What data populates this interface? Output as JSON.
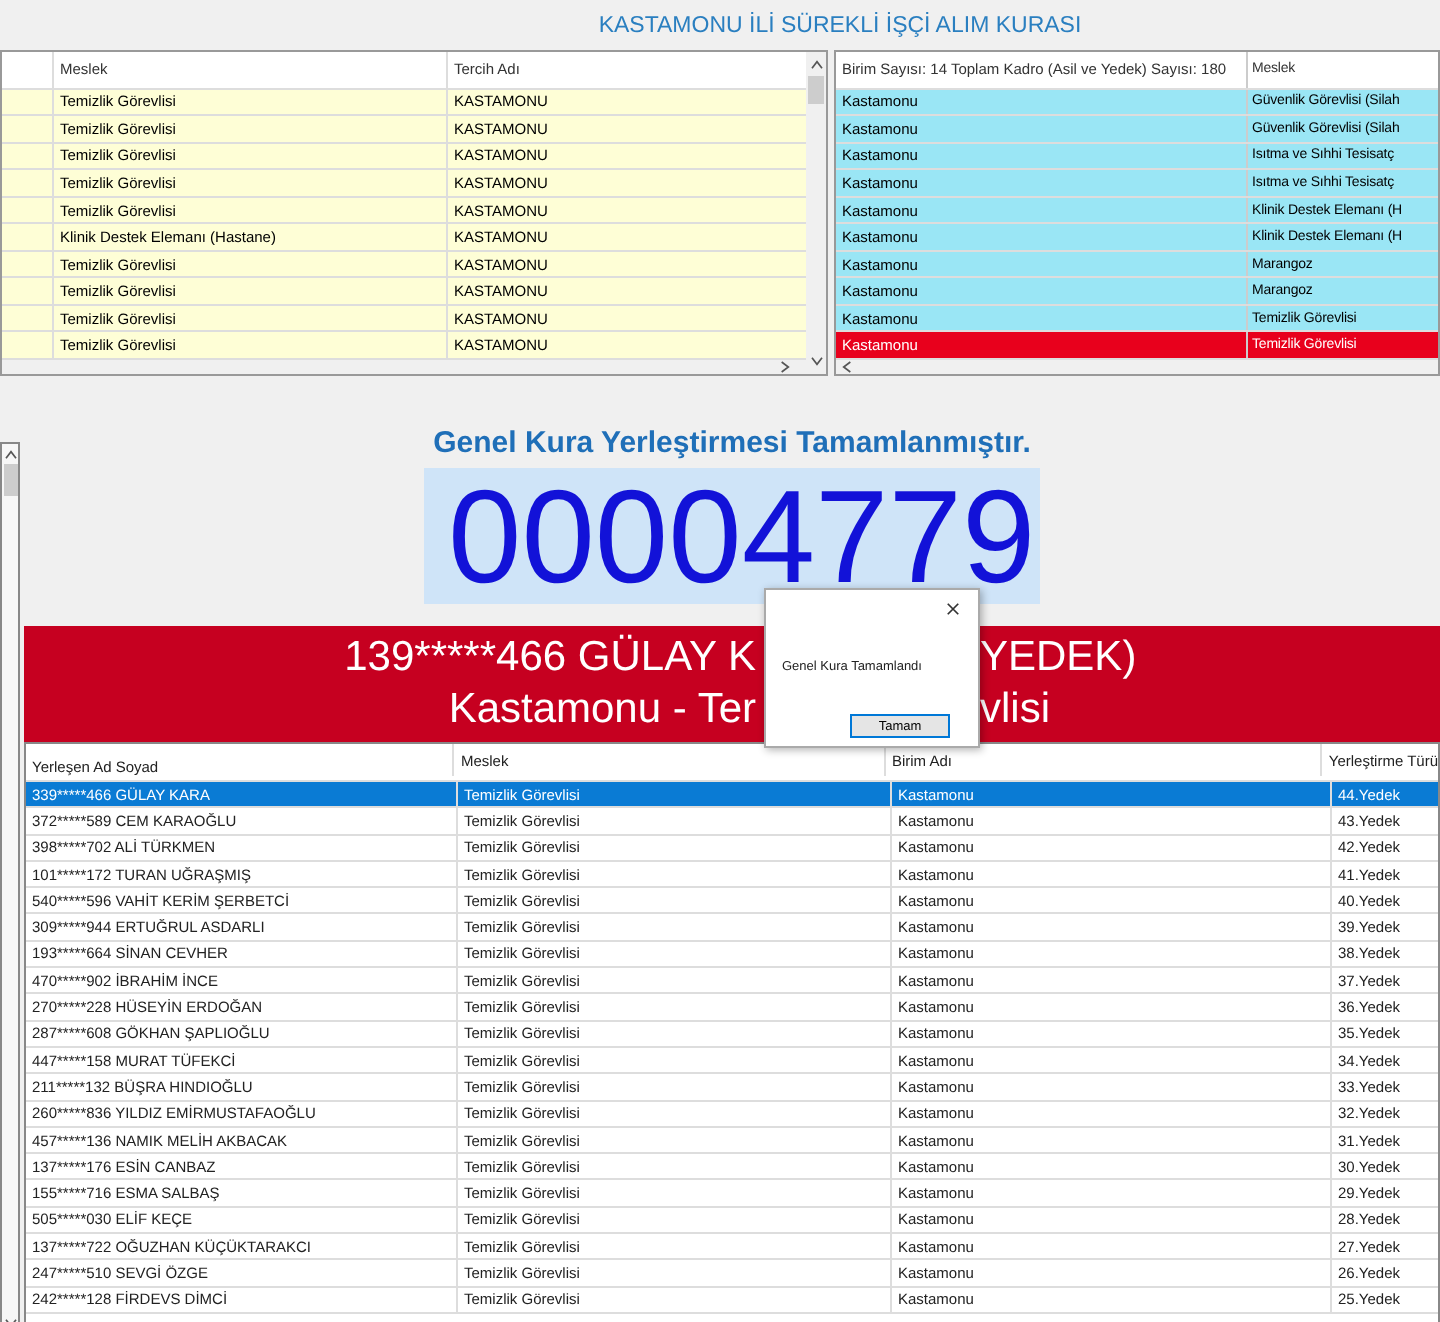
{
  "title": "KASTAMONU İLİ SÜREKLİ İŞÇİ ALIM KURASI",
  "preference_table": {
    "columns": [
      "Meslek",
      "Tercih Adı"
    ],
    "rows": [
      {
        "meslek": "Temizlik Görevlisi",
        "tercih": "KASTAMONU"
      },
      {
        "meslek": "Temizlik Görevlisi",
        "tercih": "KASTAMONU"
      },
      {
        "meslek": "Temizlik Görevlisi",
        "tercih": "KASTAMONU"
      },
      {
        "meslek": "Temizlik Görevlisi",
        "tercih": "KASTAMONU"
      },
      {
        "meslek": "Temizlik Görevlisi",
        "tercih": "KASTAMONU"
      },
      {
        "meslek": "Klinik Destek Elemanı (Hastane)",
        "tercih": "KASTAMONU"
      },
      {
        "meslek": "Temizlik Görevlisi",
        "tercih": "KASTAMONU"
      },
      {
        "meslek": "Temizlik Görevlisi",
        "tercih": "KASTAMONU"
      },
      {
        "meslek": "Temizlik Görevlisi",
        "tercih": "KASTAMONU"
      },
      {
        "meslek": "Temizlik Görevlisi",
        "tercih": "KASTAMONU"
      }
    ]
  },
  "unit_table": {
    "columns": [
      "Birim Sayısı: 14 Toplam Kadro (Asil ve Yedek) Sayısı: 180",
      "Meslek"
    ],
    "rows": [
      {
        "birim": "Kastamonu",
        "meslek": "Güvenlik Görevlisi (Silah",
        "selected": false
      },
      {
        "birim": "Kastamonu",
        "meslek": "Güvenlik Görevlisi (Silah",
        "selected": false
      },
      {
        "birim": "Kastamonu",
        "meslek": "Isıtma ve Sıhhi Tesisatç",
        "selected": false
      },
      {
        "birim": "Kastamonu",
        "meslek": "Isıtma ve Sıhhi Tesisatç",
        "selected": false
      },
      {
        "birim": "Kastamonu",
        "meslek": "Klinik Destek Elemanı (H",
        "selected": false
      },
      {
        "birim": "Kastamonu",
        "meslek": "Klinik Destek Elemanı (H",
        "selected": false
      },
      {
        "birim": "Kastamonu",
        "meslek": "Marangoz",
        "selected": false
      },
      {
        "birim": "Kastamonu",
        "meslek": "Marangoz",
        "selected": false
      },
      {
        "birim": "Kastamonu",
        "meslek": "Temizlik Görevlisi",
        "selected": false
      },
      {
        "birim": "Kastamonu",
        "meslek": "Temizlik Görevlisi",
        "selected": true
      }
    ]
  },
  "status_heading": "Genel Kura Yerleştirmesi Tamamlanmıştır.",
  "draw_number": "00004779",
  "banner": {
    "line1_left": "139*****466 GÜLAY K",
    "line1_right": "YEDEK)",
    "line2_left": "Kastamonu - Ter",
    "line2_right": "vlisi"
  },
  "dialog": {
    "message": "Genel Kura Tamamlandı",
    "button": "Tamam"
  },
  "results_table": {
    "columns": [
      "Yerleşen Ad Soyad",
      "Meslek",
      "Birim Adı",
      "Yerleştirme Türü"
    ],
    "rows": [
      {
        "name": "339*****466 GÜLAY KARA",
        "meslek": "Temizlik Görevlisi",
        "birim": "Kastamonu",
        "tur": "44.Yedek",
        "selected": true
      },
      {
        "name": "372*****589 CEM KARAOĞLU",
        "meslek": "Temizlik Görevlisi",
        "birim": "Kastamonu",
        "tur": "43.Yedek",
        "selected": false
      },
      {
        "name": "398*****702 ALİ TÜRKMEN",
        "meslek": "Temizlik Görevlisi",
        "birim": "Kastamonu",
        "tur": "42.Yedek",
        "selected": false
      },
      {
        "name": "101*****172 TURAN UĞRAŞMIŞ",
        "meslek": "Temizlik Görevlisi",
        "birim": "Kastamonu",
        "tur": "41.Yedek",
        "selected": false
      },
      {
        "name": "540*****596 VAHİT KERİM ŞERBETCİ",
        "meslek": "Temizlik Görevlisi",
        "birim": "Kastamonu",
        "tur": "40.Yedek",
        "selected": false
      },
      {
        "name": "309*****944 ERTUĞRUL ASDARLI",
        "meslek": "Temizlik Görevlisi",
        "birim": "Kastamonu",
        "tur": "39.Yedek",
        "selected": false
      },
      {
        "name": "193*****664 SİNAN CEVHER",
        "meslek": "Temizlik Görevlisi",
        "birim": "Kastamonu",
        "tur": "38.Yedek",
        "selected": false
      },
      {
        "name": "470*****902 İBRAHİM İNCE",
        "meslek": "Temizlik Görevlisi",
        "birim": "Kastamonu",
        "tur": "37.Yedek",
        "selected": false
      },
      {
        "name": "270*****228 HÜSEYİN ERDOĞAN",
        "meslek": "Temizlik Görevlisi",
        "birim": "Kastamonu",
        "tur": "36.Yedek",
        "selected": false
      },
      {
        "name": "287*****608 GÖKHAN ŞAPLIOĞLU",
        "meslek": "Temizlik Görevlisi",
        "birim": "Kastamonu",
        "tur": "35.Yedek",
        "selected": false
      },
      {
        "name": "447*****158 MURAT TÜFEKCİ",
        "meslek": "Temizlik Görevlisi",
        "birim": "Kastamonu",
        "tur": "34.Yedek",
        "selected": false
      },
      {
        "name": "211*****132 BÜŞRA HINDIOĞLU",
        "meslek": "Temizlik Görevlisi",
        "birim": "Kastamonu",
        "tur": "33.Yedek",
        "selected": false
      },
      {
        "name": "260*****836 YILDIZ EMİRMUSTAFAOĞLU",
        "meslek": "Temizlik Görevlisi",
        "birim": "Kastamonu",
        "tur": "32.Yedek",
        "selected": false
      },
      {
        "name": "457*****136 NAMIK MELİH AKBACAK",
        "meslek": "Temizlik Görevlisi",
        "birim": "Kastamonu",
        "tur": "31.Yedek",
        "selected": false
      },
      {
        "name": "137*****176 ESİN CANBAZ",
        "meslek": "Temizlik Görevlisi",
        "birim": "Kastamonu",
        "tur": "30.Yedek",
        "selected": false
      },
      {
        "name": "155*****716 ESMA SALBAŞ",
        "meslek": "Temizlik Görevlisi",
        "birim": "Kastamonu",
        "tur": "29.Yedek",
        "selected": false
      },
      {
        "name": "505*****030 ELİF KEÇE",
        "meslek": "Temizlik Görevlisi",
        "birim": "Kastamonu",
        "tur": "28.Yedek",
        "selected": false
      },
      {
        "name": "137*****722 OĞUZHAN KÜÇÜKTARAKCI",
        "meslek": "Temizlik Görevlisi",
        "birim": "Kastamonu",
        "tur": "27.Yedek",
        "selected": false
      },
      {
        "name": "247*****510 SEVGİ ÖZGE",
        "meslek": "Temizlik Görevlisi",
        "birim": "Kastamonu",
        "tur": "26.Yedek",
        "selected": false
      },
      {
        "name": "242*****128 FİRDEVS DİMCİ",
        "meslek": "Temizlik Görevlisi",
        "birim": "Kastamonu",
        "tur": "25.Yedek",
        "selected": false
      }
    ]
  }
}
